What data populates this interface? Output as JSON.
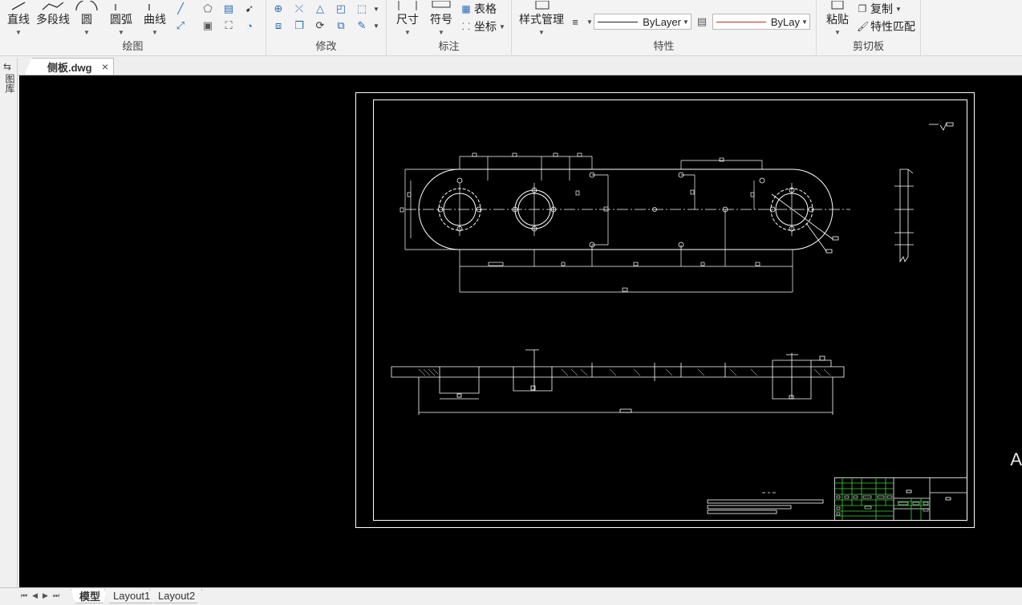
{
  "ribbon": {
    "draw": {
      "label": "绘图",
      "buttons": [
        "直线",
        "多段线",
        "圆",
        "圆弧",
        "曲线"
      ]
    },
    "modify": {
      "label": "修改"
    },
    "annotate": {
      "label": "标注",
      "dimension": "尺寸",
      "symbol": "符号",
      "table": "表格",
      "coordinate": "坐标"
    },
    "properties": {
      "label": "特性",
      "style_manager": "样式管理",
      "linetype_value": "ByLayer",
      "lineweight_value": "ByLay"
    },
    "clipboard": {
      "label": "剪切板",
      "paste": "粘贴",
      "copy": "复制",
      "match_properties": "特性匹配"
    }
  },
  "side_panel": {
    "label": "图库"
  },
  "document_tab": {
    "title": "侧板.dwg",
    "close": "×"
  },
  "layout_tabs": [
    "模型",
    "Layout1",
    "Layout2"
  ],
  "nav_buttons": "⏮◀▶⏭",
  "colors": {
    "canvas": "#000000",
    "drawing": "#ffffff",
    "titleblock_grid": "#3cd43c",
    "lineweight_red": "#c62828"
  },
  "canvas_edge_char": "A"
}
